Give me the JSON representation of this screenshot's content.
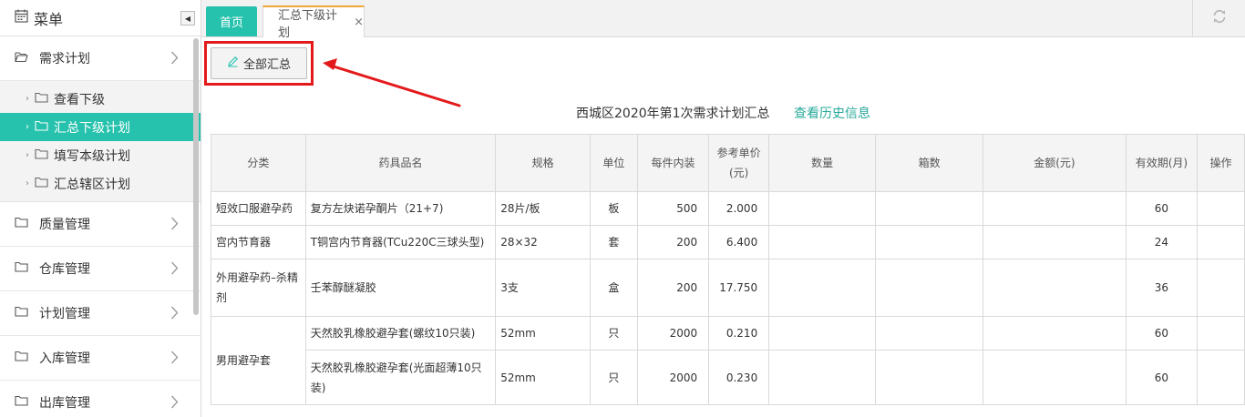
{
  "sidebar": {
    "title": "菜单",
    "groups": [
      {
        "label": "需求计划"
      },
      {
        "label": "质量管理"
      },
      {
        "label": "仓库管理"
      },
      {
        "label": "计划管理"
      },
      {
        "label": "入库管理"
      },
      {
        "label": "出库管理"
      }
    ],
    "sub_items": [
      {
        "label": "查看下级",
        "active": false
      },
      {
        "label": "汇总下级计划",
        "active": true
      },
      {
        "label": "填写本级计划",
        "active": false
      },
      {
        "label": "汇总辖区计划",
        "active": false
      }
    ]
  },
  "tabs": {
    "home": "首页",
    "active": "汇总下级计划",
    "close_symbol": "×"
  },
  "toolbar": {
    "summary_button": "全部汇总",
    "summary_icon": "pencil-icon"
  },
  "report": {
    "title": "西城区2020年第1次需求计划汇总",
    "history_link": "查看历史信息"
  },
  "table": {
    "headers": [
      "分类",
      "药具品名",
      "规格",
      "单位",
      "每件内装",
      "参考单价(元)",
      "数量",
      "箱数",
      "金额(元)",
      "有效期(月)",
      "操作"
    ],
    "rows": [
      {
        "category": "短效口服避孕药",
        "name": "复方左炔诺孕酮片（21+7)",
        "spec": "28片/板",
        "unit": "板",
        "per_pack": "500",
        "price": "2.000",
        "qty": "",
        "boxes": "",
        "amount": "",
        "validity": "60",
        "action": ""
      },
      {
        "category": "宫内节育器",
        "name": "T铜宫内节育器(TCu220C三球头型)",
        "spec": "28×32",
        "unit": "套",
        "per_pack": "200",
        "price": "6.400",
        "qty": "",
        "boxes": "",
        "amount": "",
        "validity": "24",
        "action": ""
      },
      {
        "category": "外用避孕药–杀精剂",
        "name": "壬苯醇醚凝胶",
        "spec": "3支",
        "unit": "盒",
        "per_pack": "200",
        "price": "17.750",
        "qty": "",
        "boxes": "",
        "amount": "",
        "validity": "36",
        "action": ""
      },
      {
        "category": "男用避孕套",
        "name": "天然胶乳橡胶避孕套(螺纹10只装)",
        "spec": "52mm",
        "unit": "只",
        "per_pack": "2000",
        "price": "0.210",
        "qty": "",
        "boxes": "",
        "amount": "",
        "validity": "60",
        "action": ""
      },
      {
        "category": "",
        "name": "天然胶乳橡胶避孕套(光面超薄10只装)",
        "spec": "52mm",
        "unit": "只",
        "per_pack": "2000",
        "price": "0.230",
        "qty": "",
        "boxes": "",
        "amount": "",
        "validity": "60",
        "action": ""
      }
    ]
  },
  "colors": {
    "accent": "#27c2ad",
    "tab_border": "#f0a63a",
    "highlight": "#e4191b"
  }
}
